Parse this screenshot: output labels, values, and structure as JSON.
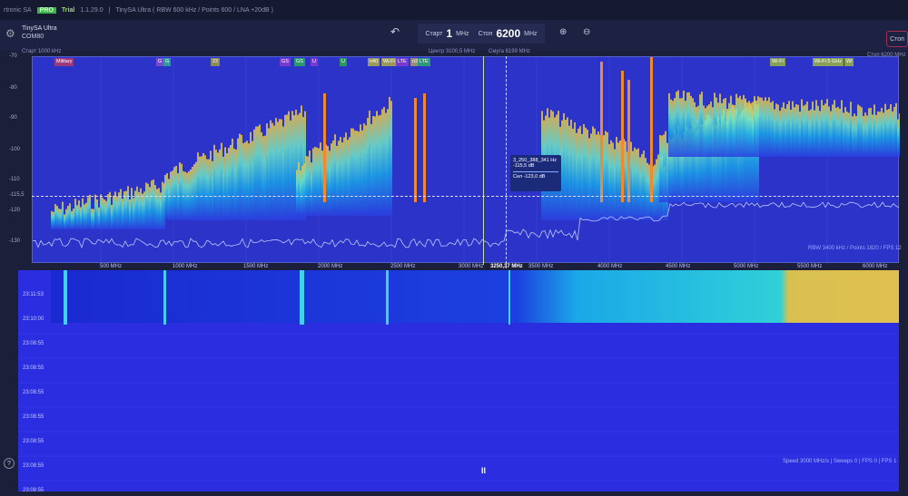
{
  "topbar": {
    "app": "rtronic SA",
    "pro_badge": "PRO",
    "trial": "Trial",
    "version": "1.1.29.0",
    "separator": "|",
    "device_info": "TinySA Ultra  ( RBW 600 kHz / Points 600 / LNA +20dB )"
  },
  "device": {
    "name": "TinySA Ultra",
    "port": "COM80"
  },
  "range": {
    "start_label": "Старт",
    "start_value": "1",
    "start_unit": "MHz",
    "stop_label": "Стоп",
    "stop_value": "6200",
    "stop_unit": "MHz"
  },
  "subinfo": {
    "start": "Старт 1000 kHz",
    "center": "Центр 3100,5 MHz",
    "span": "Смуга 6199 MHz",
    "stop": "Стоп 6200 MHz",
    "stop_button": "Стоп"
  },
  "y_ticks": [
    "-70",
    "-80",
    "-90",
    "-100",
    "-110",
    "-115,5",
    "-120",
    "-130"
  ],
  "x_ticks": [
    "500 MHz",
    "1000 MHz",
    "1500 MHz",
    "2000 MHz",
    "2500 MHz",
    "3000 MHz",
    "3250,37 MHz",
    "3500 MHz",
    "4000 MHz",
    "4500 MHz",
    "5000 MHz",
    "5500 MHz",
    "6000 MHz"
  ],
  "band_markers": [
    {
      "label": "Military",
      "color": "#9a3a7a"
    },
    {
      "label": "G",
      "color": "#7a4ad0"
    },
    {
      "label": "G",
      "color": "#2a9a9a"
    },
    {
      "label": "23",
      "color": "#8a8a5a"
    },
    {
      "label": "GS",
      "color": "#7a3ad0"
    },
    {
      "label": "GS",
      "color": "#2a9a6a"
    },
    {
      "label": "U",
      "color": "#7a3ad0"
    },
    {
      "label": "U",
      "color": "#2a9a5a"
    },
    {
      "label": "n40",
      "color": "#9a9a5a"
    },
    {
      "label": "Wi-Fi",
      "color": "#9a9a5a"
    },
    {
      "label": "LTE",
      "color": "#7a3ad0"
    },
    {
      "label": "n3",
      "color": "#9a8a7a"
    },
    {
      "label": "LTE",
      "color": "#2a9a7a"
    },
    {
      "label": "Wi-Fi",
      "color": "#8aa05a"
    },
    {
      "label": "Wi-Fi 5 GHz",
      "color": "#8aa05a"
    },
    {
      "label": "Wi",
      "color": "#8aa05a"
    }
  ],
  "cursor": {
    "freq": "3_250_388_341 Hz",
    "level": "-115,5 dB",
    "avg": "Сел -123,0 dB"
  },
  "chart_status": "RBW 3400 kHz / Points 1820 / FPS 12",
  "waterfall": {
    "times": [
      "23:11:53",
      "23:10:00",
      "23:08:55",
      "23:08:55",
      "23:08:55",
      "23:08:55",
      "23:08:55",
      "23:08:55",
      "23:08:55"
    ],
    "status": "Speed 3000 MHz/s | Sweeps 0 | FPS 0 | FPS 1",
    "pause": "II"
  }
}
